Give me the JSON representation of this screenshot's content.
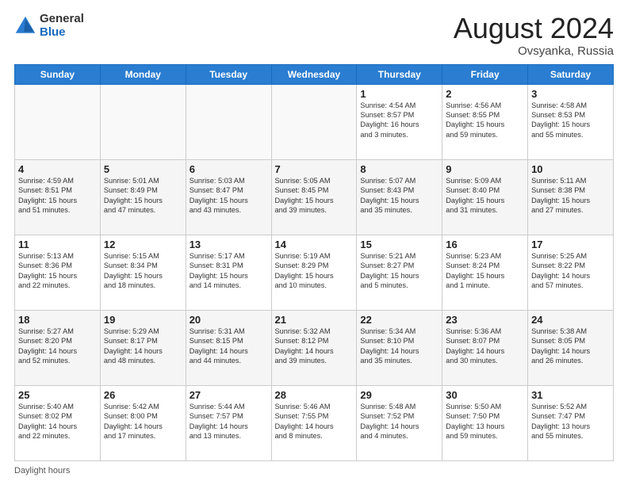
{
  "header": {
    "logo_general": "General",
    "logo_blue": "Blue",
    "title": "August 2024",
    "location": "Ovsyanka, Russia"
  },
  "footer": {
    "label": "Daylight hours"
  },
  "calendar": {
    "days_of_week": [
      "Sunday",
      "Monday",
      "Tuesday",
      "Wednesday",
      "Thursday",
      "Friday",
      "Saturday"
    ],
    "weeks": [
      [
        {
          "day": "",
          "info": ""
        },
        {
          "day": "",
          "info": ""
        },
        {
          "day": "",
          "info": ""
        },
        {
          "day": "",
          "info": ""
        },
        {
          "day": "1",
          "info": "Sunrise: 4:54 AM\nSunset: 8:57 PM\nDaylight: 16 hours\nand 3 minutes."
        },
        {
          "day": "2",
          "info": "Sunrise: 4:56 AM\nSunset: 8:55 PM\nDaylight: 15 hours\nand 59 minutes."
        },
        {
          "day": "3",
          "info": "Sunrise: 4:58 AM\nSunset: 8:53 PM\nDaylight: 15 hours\nand 55 minutes."
        }
      ],
      [
        {
          "day": "4",
          "info": "Sunrise: 4:59 AM\nSunset: 8:51 PM\nDaylight: 15 hours\nand 51 minutes."
        },
        {
          "day": "5",
          "info": "Sunrise: 5:01 AM\nSunset: 8:49 PM\nDaylight: 15 hours\nand 47 minutes."
        },
        {
          "day": "6",
          "info": "Sunrise: 5:03 AM\nSunset: 8:47 PM\nDaylight: 15 hours\nand 43 minutes."
        },
        {
          "day": "7",
          "info": "Sunrise: 5:05 AM\nSunset: 8:45 PM\nDaylight: 15 hours\nand 39 minutes."
        },
        {
          "day": "8",
          "info": "Sunrise: 5:07 AM\nSunset: 8:43 PM\nDaylight: 15 hours\nand 35 minutes."
        },
        {
          "day": "9",
          "info": "Sunrise: 5:09 AM\nSunset: 8:40 PM\nDaylight: 15 hours\nand 31 minutes."
        },
        {
          "day": "10",
          "info": "Sunrise: 5:11 AM\nSunset: 8:38 PM\nDaylight: 15 hours\nand 27 minutes."
        }
      ],
      [
        {
          "day": "11",
          "info": "Sunrise: 5:13 AM\nSunset: 8:36 PM\nDaylight: 15 hours\nand 22 minutes."
        },
        {
          "day": "12",
          "info": "Sunrise: 5:15 AM\nSunset: 8:34 PM\nDaylight: 15 hours\nand 18 minutes."
        },
        {
          "day": "13",
          "info": "Sunrise: 5:17 AM\nSunset: 8:31 PM\nDaylight: 15 hours\nand 14 minutes."
        },
        {
          "day": "14",
          "info": "Sunrise: 5:19 AM\nSunset: 8:29 PM\nDaylight: 15 hours\nand 10 minutes."
        },
        {
          "day": "15",
          "info": "Sunrise: 5:21 AM\nSunset: 8:27 PM\nDaylight: 15 hours\nand 5 minutes."
        },
        {
          "day": "16",
          "info": "Sunrise: 5:23 AM\nSunset: 8:24 PM\nDaylight: 15 hours\nand 1 minute."
        },
        {
          "day": "17",
          "info": "Sunrise: 5:25 AM\nSunset: 8:22 PM\nDaylight: 14 hours\nand 57 minutes."
        }
      ],
      [
        {
          "day": "18",
          "info": "Sunrise: 5:27 AM\nSunset: 8:20 PM\nDaylight: 14 hours\nand 52 minutes."
        },
        {
          "day": "19",
          "info": "Sunrise: 5:29 AM\nSunset: 8:17 PM\nDaylight: 14 hours\nand 48 minutes."
        },
        {
          "day": "20",
          "info": "Sunrise: 5:31 AM\nSunset: 8:15 PM\nDaylight: 14 hours\nand 44 minutes."
        },
        {
          "day": "21",
          "info": "Sunrise: 5:32 AM\nSunset: 8:12 PM\nDaylight: 14 hours\nand 39 minutes."
        },
        {
          "day": "22",
          "info": "Sunrise: 5:34 AM\nSunset: 8:10 PM\nDaylight: 14 hours\nand 35 minutes."
        },
        {
          "day": "23",
          "info": "Sunrise: 5:36 AM\nSunset: 8:07 PM\nDaylight: 14 hours\nand 30 minutes."
        },
        {
          "day": "24",
          "info": "Sunrise: 5:38 AM\nSunset: 8:05 PM\nDaylight: 14 hours\nand 26 minutes."
        }
      ],
      [
        {
          "day": "25",
          "info": "Sunrise: 5:40 AM\nSunset: 8:02 PM\nDaylight: 14 hours\nand 22 minutes."
        },
        {
          "day": "26",
          "info": "Sunrise: 5:42 AM\nSunset: 8:00 PM\nDaylight: 14 hours\nand 17 minutes."
        },
        {
          "day": "27",
          "info": "Sunrise: 5:44 AM\nSunset: 7:57 PM\nDaylight: 14 hours\nand 13 minutes."
        },
        {
          "day": "28",
          "info": "Sunrise: 5:46 AM\nSunset: 7:55 PM\nDaylight: 14 hours\nand 8 minutes."
        },
        {
          "day": "29",
          "info": "Sunrise: 5:48 AM\nSunset: 7:52 PM\nDaylight: 14 hours\nand 4 minutes."
        },
        {
          "day": "30",
          "info": "Sunrise: 5:50 AM\nSunset: 7:50 PM\nDaylight: 13 hours\nand 59 minutes."
        },
        {
          "day": "31",
          "info": "Sunrise: 5:52 AM\nSunset: 7:47 PM\nDaylight: 13 hours\nand 55 minutes."
        }
      ]
    ]
  }
}
